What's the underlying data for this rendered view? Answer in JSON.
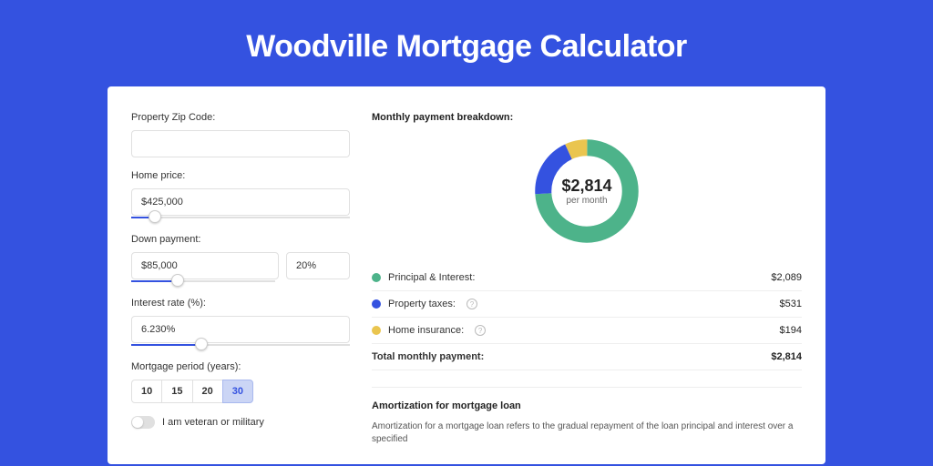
{
  "title": "Woodville Mortgage Calculator",
  "form": {
    "zip_label": "Property Zip Code:",
    "zip_value": "",
    "home_price_label": "Home price:",
    "home_price_value": "$425,000",
    "down_payment_label": "Down payment:",
    "down_payment_amount": "$85,000",
    "down_payment_percent": "20%",
    "interest_rate_label": "Interest rate (%):",
    "interest_rate_value": "6.230%",
    "period_label": "Mortgage period (years):",
    "period_options": [
      "10",
      "15",
      "20",
      "30"
    ],
    "period_selected": "30",
    "veteran_label": "I am veteran or military"
  },
  "breakdown": {
    "heading": "Monthly payment breakdown:",
    "amount": "$2,814",
    "sub": "per month",
    "rows": {
      "pi_label": "Principal & Interest:",
      "pi_value": "$2,089",
      "tax_label": "Property taxes:",
      "tax_value": "$531",
      "ins_label": "Home insurance:",
      "ins_value": "$194",
      "total_label": "Total monthly payment:",
      "total_value": "$2,814"
    }
  },
  "amort": {
    "heading": "Amortization for mortgage loan",
    "text": "Amortization for a mortgage loan refers to the gradual repayment of the loan principal and interest over a specified"
  },
  "chart_data": {
    "type": "pie",
    "title": "Monthly payment breakdown",
    "series": [
      {
        "name": "Principal & Interest",
        "value": 2089,
        "color": "#4db38a"
      },
      {
        "name": "Property taxes",
        "value": 531,
        "color": "#3452e0"
      },
      {
        "name": "Home insurance",
        "value": 194,
        "color": "#eac54f"
      }
    ],
    "total": 2814,
    "center_label": "$2,814 per month"
  }
}
